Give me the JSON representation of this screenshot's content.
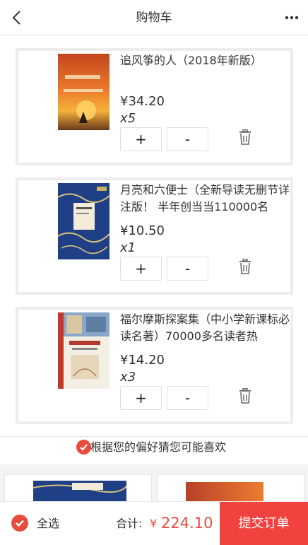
{
  "nav": {
    "title": "购物车",
    "back_icon": "chevron-left-icon",
    "more_icon": "more-dots-icon"
  },
  "items": [
    {
      "title": "追风筝的人（2018年新版）",
      "price": "¥34.20",
      "qty": "x5",
      "plus": "+",
      "minus": "-",
      "checked": true
    },
    {
      "title": "月亮和六便士（全新导读无删节详注版！ 半年创当当110000名",
      "price": "¥10.50",
      "qty": "x1",
      "plus": "+",
      "minus": "-",
      "checked": true
    },
    {
      "title": "福尔摩斯探案集（中小学新课标必读名著）70000多名读者热",
      "price": "¥14.20",
      "qty": "x3",
      "plus": "+",
      "minus": "-",
      "checked": true
    }
  ],
  "recommend": {
    "label": "根据您的偏好猜您可能喜欢"
  },
  "footer": {
    "select_all": "全选",
    "total_label": "合计:",
    "currency": "¥",
    "total": "224.10",
    "submit": "提交订单"
  },
  "colors": {
    "accent": "#e74c3c",
    "submit_bg": "#f2423f",
    "border": "#ededed"
  }
}
